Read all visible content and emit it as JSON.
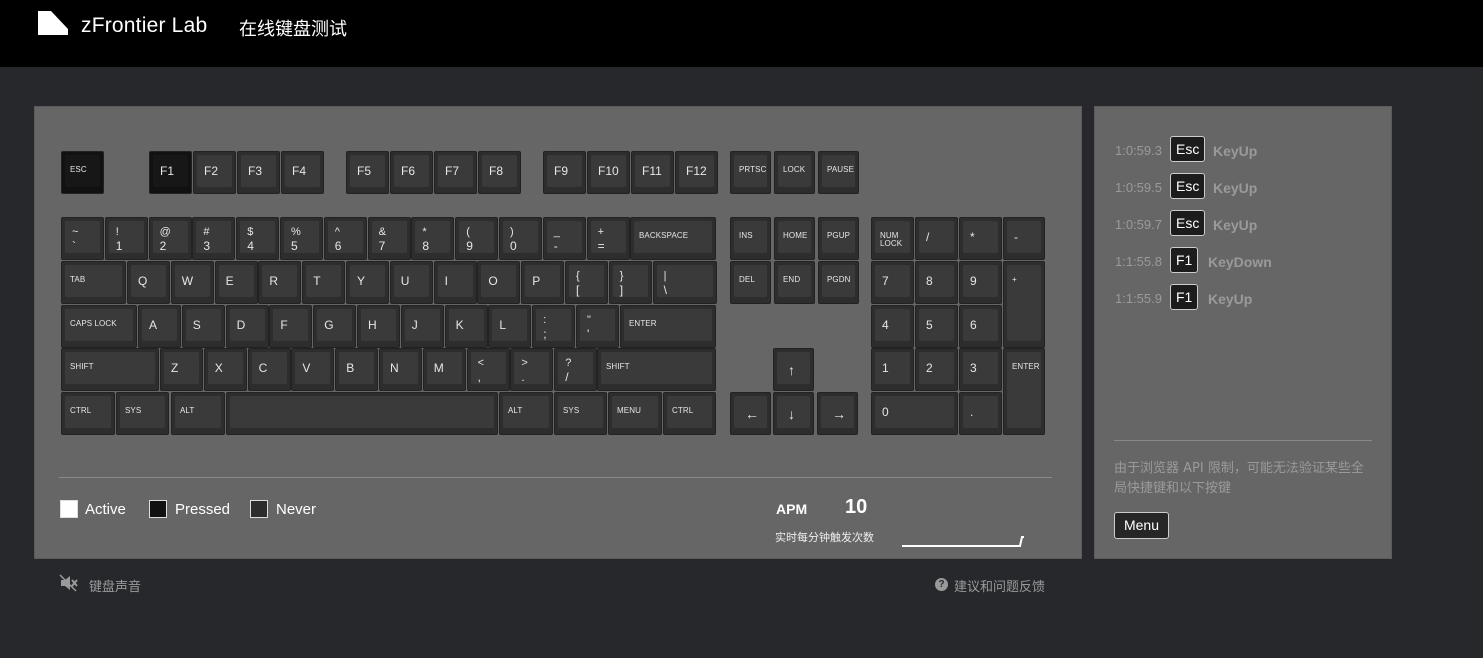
{
  "header": {
    "brand": "zFrontier Lab",
    "subtitle": "在线键盘测试"
  },
  "keyboard": {
    "function_row": [
      "ESC",
      "F1",
      "F2",
      "F3",
      "F4",
      "F5",
      "F6",
      "F7",
      "F8",
      "F9",
      "F10",
      "F11",
      "F12",
      "PRTSC",
      "LOCK",
      "PAUSE"
    ],
    "number_row": [
      {
        "top": "~",
        "bottom": "`"
      },
      {
        "top": "!",
        "bottom": "1"
      },
      {
        "top": "@",
        "bottom": "2"
      },
      {
        "top": "#",
        "bottom": "3"
      },
      {
        "top": "$",
        "bottom": "4"
      },
      {
        "top": "%",
        "bottom": "5"
      },
      {
        "top": "^",
        "bottom": "6"
      },
      {
        "top": "&",
        "bottom": "7"
      },
      {
        "top": "*",
        "bottom": "8"
      },
      {
        "top": "(",
        "bottom": "9"
      },
      {
        "top": ")",
        "bottom": "0"
      },
      {
        "top": "_",
        "bottom": "-"
      },
      {
        "top": "+",
        "bottom": "="
      },
      {
        "label": "BACKSPACE"
      }
    ],
    "tab_row": [
      {
        "label": "TAB"
      },
      {
        "label": "Q"
      },
      {
        "label": "W"
      },
      {
        "label": "E"
      },
      {
        "label": "R"
      },
      {
        "label": "T"
      },
      {
        "label": "Y"
      },
      {
        "label": "U"
      },
      {
        "label": "I"
      },
      {
        "label": "O"
      },
      {
        "label": "P"
      },
      {
        "top": "{",
        "bottom": "["
      },
      {
        "top": "}",
        "bottom": "]"
      },
      {
        "top": "|",
        "bottom": "\\"
      }
    ],
    "caps_row": [
      {
        "label": "CAPS LOCK"
      },
      {
        "label": "A"
      },
      {
        "label": "S"
      },
      {
        "label": "D"
      },
      {
        "label": "F"
      },
      {
        "label": "G"
      },
      {
        "label": "H"
      },
      {
        "label": "J"
      },
      {
        "label": "K"
      },
      {
        "label": "L"
      },
      {
        "top": ":",
        "bottom": ";"
      },
      {
        "top": "\"",
        "bottom": "'"
      },
      {
        "label": "ENTER"
      }
    ],
    "shift_row": [
      {
        "label": "SHIFT"
      },
      {
        "label": "Z"
      },
      {
        "label": "X"
      },
      {
        "label": "C"
      },
      {
        "label": "V"
      },
      {
        "label": "B"
      },
      {
        "label": "N"
      },
      {
        "label": "M"
      },
      {
        "top": "<",
        "bottom": ","
      },
      {
        "top": ">",
        "bottom": "."
      },
      {
        "top": "?",
        "bottom": "/"
      },
      {
        "label": "SHIFT"
      }
    ],
    "bottom_row": [
      "CTRL",
      "SYS",
      "ALT",
      "",
      "ALT",
      "SYS",
      "MENU",
      "CTRL"
    ],
    "nav_cluster": [
      "INS",
      "HOME",
      "PGUP",
      "DEL",
      "END",
      "PGDN"
    ],
    "arrows": {
      "up": "↑",
      "left": "←",
      "down": "↓",
      "right": "→"
    },
    "numpad": [
      "NUM LOCK",
      "/",
      "*",
      "-",
      "7",
      "8",
      "9",
      "+",
      "4",
      "5",
      "6",
      "1",
      "2",
      "3",
      "ENTER",
      "0",
      "."
    ],
    "pressed_keys": [
      "ESC",
      "F1"
    ]
  },
  "legend": [
    {
      "label": "Active",
      "color": "#ffffff"
    },
    {
      "label": "Pressed",
      "color": "#111111"
    },
    {
      "label": "Never",
      "color": "#2d2d2d"
    }
  ],
  "apm": {
    "label": "APM",
    "value": "10",
    "description": "实时每分钟触发次数"
  },
  "log": [
    {
      "time": "1:0:59.3",
      "key": "Esc",
      "event": "KeyUp"
    },
    {
      "time": "1:0:59.5",
      "key": "Esc",
      "event": "KeyUp"
    },
    {
      "time": "1:0:59.7",
      "key": "Esc",
      "event": "KeyUp"
    },
    {
      "time": "1:1:55.8",
      "key": "F1",
      "event": "KeyDown"
    },
    {
      "time": "1:1:55.9",
      "key": "F1",
      "event": "KeyUp"
    }
  ],
  "side": {
    "note": "由于浏览器 API 限制，可能无法验证某些全局快捷键和以下按键",
    "menu_label": "Menu"
  },
  "footer": {
    "sound_label": "键盘声音",
    "feedback_label": "建议和问题反馈",
    "feedback_icon": "?"
  }
}
